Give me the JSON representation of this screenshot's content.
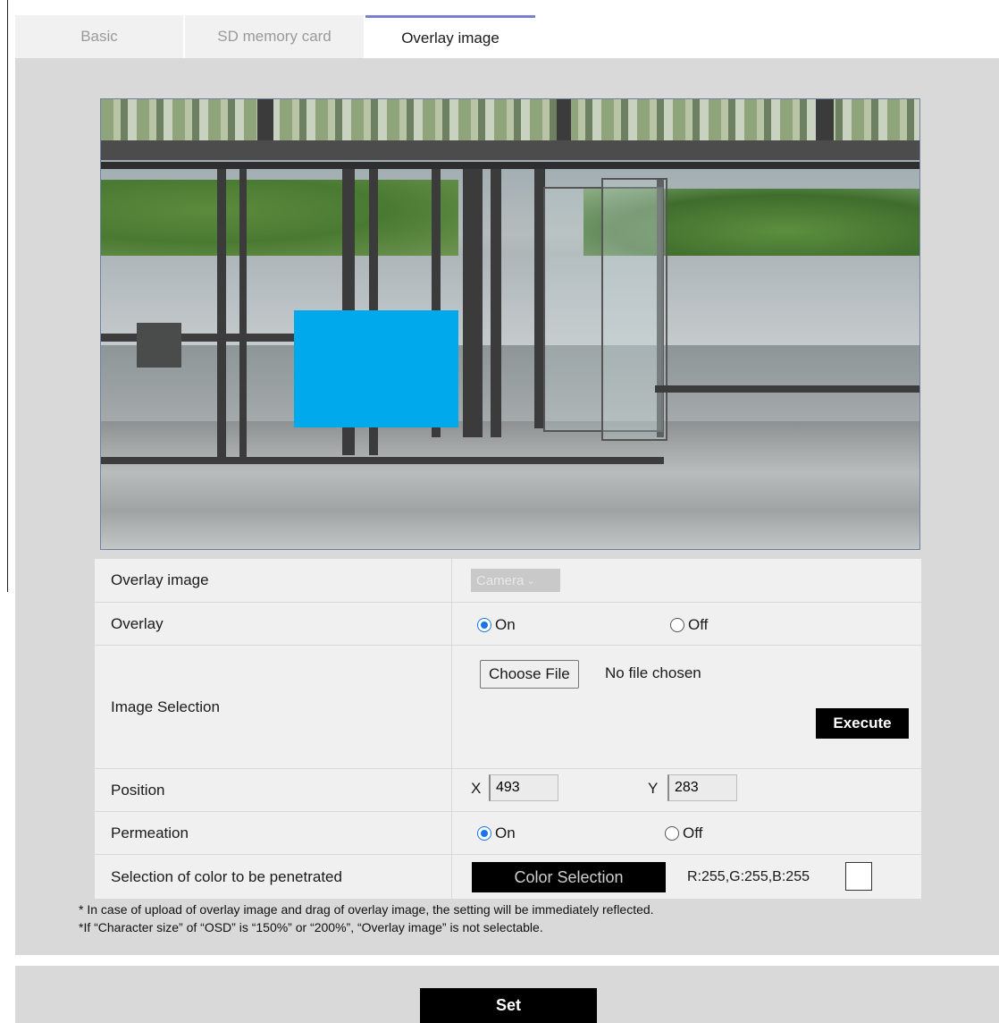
{
  "tabs": [
    {
      "label": "Basic",
      "active": false
    },
    {
      "label": "SD memory card",
      "active": false
    },
    {
      "label": "Overlay image",
      "active": true
    }
  ],
  "settings": {
    "overlay_image": {
      "label": "Overlay image",
      "select_value": "Camera",
      "disabled": true
    },
    "overlay": {
      "label": "Overlay",
      "on_label": "On",
      "off_label": "Off",
      "selected": "On"
    },
    "image_selection": {
      "label": "Image Selection",
      "choose_file_label": "Choose File",
      "file_status": "No file chosen",
      "execute_label": "Execute"
    },
    "position": {
      "label": "Position",
      "x_label": "X",
      "x_value": "493",
      "y_label": "Y",
      "y_value": "283"
    },
    "permeation": {
      "label": "Permeation",
      "on_label": "On",
      "off_label": "Off",
      "selected": "On"
    },
    "penetrate_color": {
      "label": "Selection of color to be penetrated",
      "button_label": "Color Selection",
      "rgb_text": "R:255,G:255,B:255",
      "swatch_color": "#ffffff"
    }
  },
  "notes": [
    "* In case of upload of overlay image and drag of overlay image, the setting will be immediately reflected.",
    "*If “Character size” of “OSD” is “150%” or “200%”, “Overlay image” is not selectable."
  ],
  "footer": {
    "set_label": "Set"
  },
  "colors": {
    "overlay_box": "#00a9eb",
    "active_tab_border": "#7a7fd0",
    "panel_bg": "#d9d9d9"
  }
}
